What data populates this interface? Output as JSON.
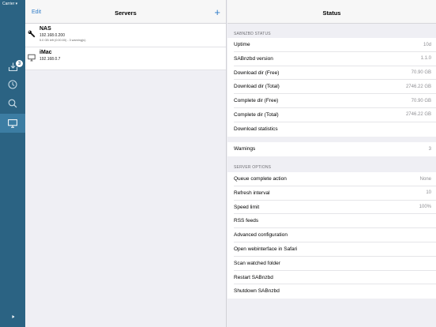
{
  "status_bar": {
    "carrier": "Carrier"
  },
  "sidebar": {
    "tabs": [
      {
        "name": "downloads",
        "icon": "download-tray-icon",
        "badge": "3"
      },
      {
        "name": "history",
        "icon": "clock-icon"
      },
      {
        "name": "search",
        "icon": "search-icon"
      },
      {
        "name": "servers",
        "icon": "monitor-icon",
        "active": true
      }
    ],
    "expand_icon": "play-icon"
  },
  "servers": {
    "title": "Servers",
    "edit_label": "Edit",
    "add_label": "+",
    "items": [
      {
        "name": "NAS",
        "ip": "192.168.0.200",
        "status": "5.0 GB left (0:00:00) - 3 warning(s)",
        "icon": "wrench-icon"
      },
      {
        "name": "iMac",
        "ip": "192.168.0.7",
        "icon": "monitor-icon"
      }
    ]
  },
  "status": {
    "title": "Status",
    "sabnzbd_header": "SABNZBD STATUS",
    "sabnzbd_rows": [
      {
        "label": "Uptime",
        "value": "10d"
      },
      {
        "label": "SABnzbd version",
        "value": "1.1.0"
      },
      {
        "label": "Download dir (Free)",
        "value": "70.90 GB"
      },
      {
        "label": "Download dir (Total)",
        "value": "2746.22 GB"
      },
      {
        "label": "Complete dir (Free)",
        "value": "70.90 GB"
      },
      {
        "label": "Complete dir (Total)",
        "value": "2746.22 GB"
      },
      {
        "label": "Download statistics",
        "value": ""
      }
    ],
    "warnings_row": {
      "label": "Warnings",
      "value": "3"
    },
    "server_header": "SERVER OPTIONS",
    "server_rows": [
      {
        "label": "Queue complete action",
        "value": "None"
      },
      {
        "label": "Refresh interval",
        "value": "10"
      },
      {
        "label": "Speed limit",
        "value": "100%"
      },
      {
        "label": "RSS feeds",
        "value": ""
      },
      {
        "label": "Advanced configuration",
        "value": ""
      },
      {
        "label": "Open webinterface in Safari",
        "value": ""
      },
      {
        "label": "Scan watched folder",
        "value": ""
      },
      {
        "label": "Restart SABnzbd",
        "value": ""
      },
      {
        "label": "Shutdown SABnzbd",
        "value": ""
      }
    ]
  },
  "colors": {
    "sidebar": "#2b6383",
    "sidebar_active": "#3c7da3",
    "accent": "#2f7cc8",
    "background": "#efeff4"
  }
}
